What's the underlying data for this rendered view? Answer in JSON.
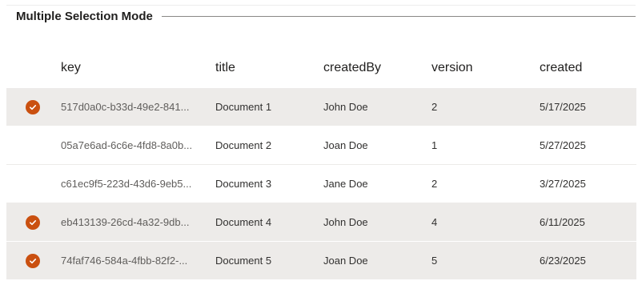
{
  "section": {
    "title": "Multiple Selection Mode"
  },
  "grid": {
    "columns": [
      "key",
      "title",
      "createdBy",
      "version",
      "created"
    ],
    "rows": [
      {
        "selected": true,
        "key": "517d0a0c-b33d-49e2-841...",
        "title": "Document 1",
        "createdBy": "John Doe",
        "version": "2",
        "created": "5/17/2025"
      },
      {
        "selected": false,
        "key": "05a7e6ad-6c6e-4fd8-8a0b...",
        "title": "Document 2",
        "createdBy": "Joan Doe",
        "version": "1",
        "created": "5/27/2025"
      },
      {
        "selected": false,
        "key": "c61ec9f5-223d-43d6-9eb5...",
        "title": "Document 3",
        "createdBy": "Jane Doe",
        "version": "2",
        "created": "3/27/2025"
      },
      {
        "selected": true,
        "key": "eb413139-26cd-4a32-9db...",
        "title": "Document 4",
        "createdBy": "John Doe",
        "version": "4",
        "created": "6/11/2025"
      },
      {
        "selected": true,
        "key": "74faf746-584a-4fbb-82f2-...",
        "title": "Document 5",
        "createdBy": "Joan Doe",
        "version": "5",
        "created": "6/23/2025"
      }
    ]
  },
  "colors": {
    "check_accent": "#ca5010",
    "selected_row_bg": "#edebe9"
  },
  "icons": {
    "row_selected": "checkmark-circle-icon"
  }
}
